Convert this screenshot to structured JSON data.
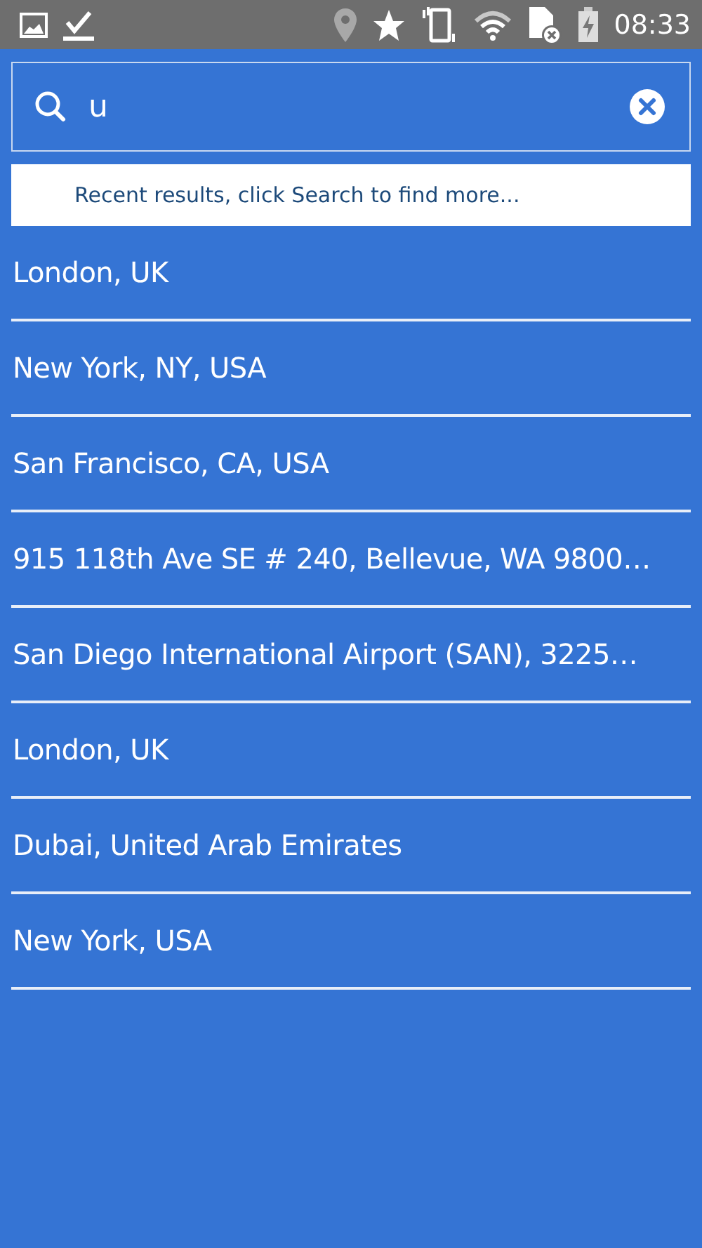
{
  "status_bar": {
    "time": "08:33"
  },
  "search": {
    "value": "u"
  },
  "notice": "Recent results, click Search to find more...",
  "results": [
    {
      "label": "London, UK"
    },
    {
      "label": "New York, NY, USA"
    },
    {
      "label": "San Francisco, CA, USA"
    },
    {
      "label": "915 118th Ave SE # 240, Bellevue, WA 9800…"
    },
    {
      "label": "San Diego International Airport (SAN), 3225…"
    },
    {
      "label": "London, UK"
    },
    {
      "label": "Dubai, United Arab Emirates"
    },
    {
      "label": "New York, USA"
    }
  ]
}
